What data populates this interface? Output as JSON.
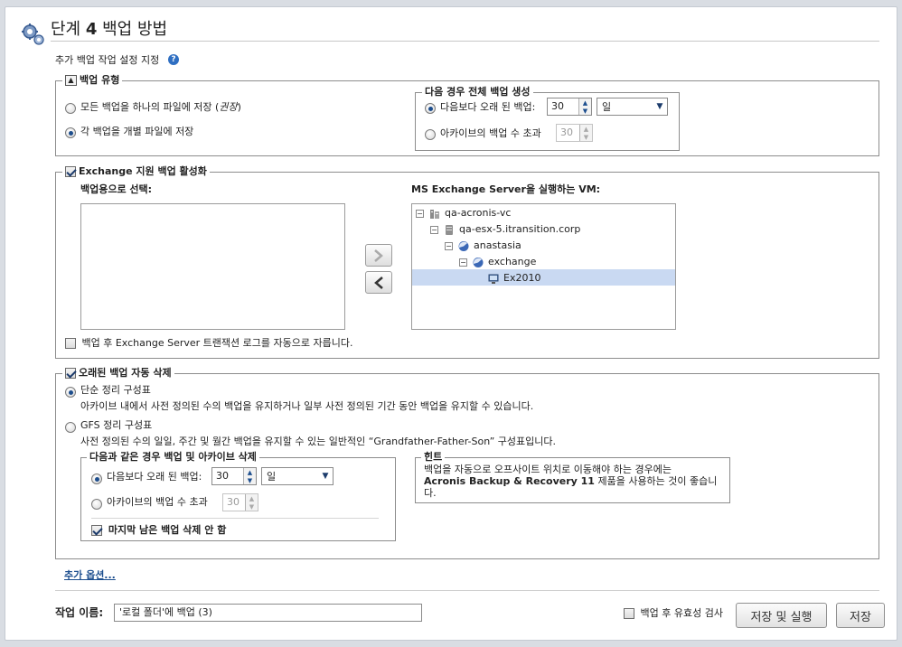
{
  "header": {
    "step_label": "단계",
    "step_number": "4",
    "title": "백업 방법",
    "subtitle": "추가 백업 작업 설정 지정"
  },
  "backup_type": {
    "legend": "백업 유형",
    "option_single": "모든 백업을 하나의 파일에 저장 (",
    "option_single_tag": "권장",
    "option_single_end": ")",
    "option_separate": "각 백업을 개별 파일에 저장",
    "selected": "separate",
    "full_backup": {
      "legend": "다음 경우 전체 백업 생성",
      "older_label": "다음보다 오래 된 백업:",
      "older_value": "30",
      "older_unit": "일",
      "count_label": "아카이브의 백업 수 초과",
      "count_value": "30"
    }
  },
  "exchange": {
    "legend": "Exchange 지원 백업 활성화",
    "enabled": true,
    "select_label": "백업용으로 선택:",
    "vm_label": "MS Exchange Server을 실행하는 VM:",
    "truncate_label": "백업 후 Exchange Server 트랜잭션 로그를 자동으로 자릅니다.",
    "tree": [
      {
        "label": "qa-acronis-vc",
        "icon": "datacenter-icon"
      },
      {
        "label": "qa-esx-5.itransition.corp",
        "icon": "server-icon"
      },
      {
        "label": "anastasia",
        "icon": "resource-pool-icon"
      },
      {
        "label": "exchange",
        "icon": "resource-pool-icon"
      },
      {
        "label": "Ex2010",
        "icon": "vm-icon"
      }
    ]
  },
  "cleanup": {
    "legend": "오래된 백업 자동 삭제",
    "enabled": true,
    "simple_label": "단순 정리 구성표",
    "simple_desc": "아카이브 내에서 사전 정의된 수의 백업을 유지하거나 일부 사전 정의된 기간 동안 백업을 유지할 수 있습니다.",
    "gfs_label": "GFS 정리 구성표",
    "gfs_desc": "사전 정의된 수의 일일, 주간 및 월간 백업을 유지할 수 있는 일반적인 “Grandfather-Father-Son” 구성표입니다.",
    "delete": {
      "legend": "다음과 같은 경우 백업 및 아카이브 삭제",
      "older_label": "다음보다 오래 된 백업:",
      "older_value": "30",
      "older_unit": "일",
      "count_label": "아카이브의 백업 수 초과",
      "count_value": "30",
      "keep_last_label": "마지막 남은 백업 삭제 안 함"
    },
    "hint": {
      "legend": "힌트",
      "line1": "백업을 자동으로 오프사이트 위치로 이동해야 하는 경우에는",
      "product": "Acronis Backup & Recovery 11",
      "line2_rest": " 제품을 사용하는 것이 좋습니",
      "line3": "다."
    }
  },
  "more_options": "추가 옵션...",
  "footer": {
    "task_name_label": "작업 이름:",
    "task_name_value": "'로컬 폴더'에 백업 (3)",
    "validate_label": "백업 후 유효성 검사",
    "save_run": "저장 및 실행",
    "save": "저장"
  },
  "colors": {
    "link": "#1c4e8e",
    "tree_selection": "#c9d9f2"
  }
}
